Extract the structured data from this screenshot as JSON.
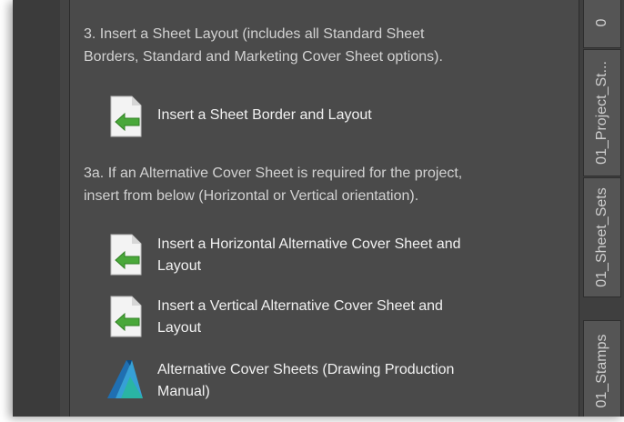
{
  "panel": {
    "step3_text": [
      "3. Insert a Sheet Layout (includes all Standard Sheet",
      "Borders, Standard and Marketing Cover Sheet options)."
    ],
    "step3a_text": [
      "3a. If an Alternative Cover Sheet is required for the project,",
      "insert from below (Horizontal or Vertical orientation)."
    ],
    "items": [
      {
        "label": [
          "Insert a Sheet Border and Layout"
        ],
        "icon": "insert-sheet-icon"
      },
      {
        "label": [
          "Insert a Horizontal Alternative Cover Sheet and",
          "Layout"
        ],
        "icon": "insert-sheet-icon"
      },
      {
        "label": [
          "Insert a Vertical Alternative Cover Sheet and",
          "Layout"
        ],
        "icon": "insert-sheet-icon"
      },
      {
        "label": [
          "Alternative Cover Sheets (Drawing Production",
          "Manual)"
        ],
        "icon": "autodesk-logo-icon"
      }
    ]
  },
  "tabs": [
    "0",
    "01_Project_St...",
    "01_Sheet_Sets",
    "01_Stamps"
  ],
  "colors": {
    "panel_bg": "#4a4a4a",
    "text": "#d2d2d2",
    "label": "#f1f1f1",
    "arrow_green": "#4aa83a"
  }
}
